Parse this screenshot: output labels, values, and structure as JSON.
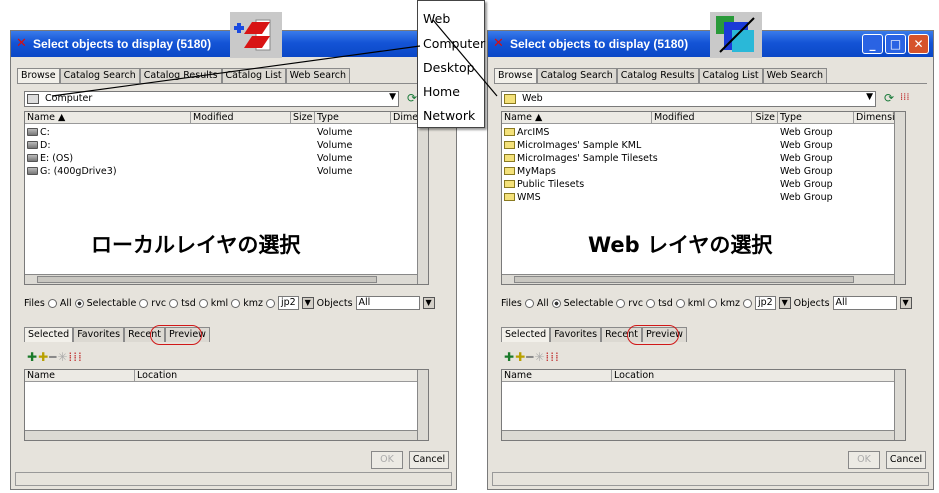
{
  "popup": {
    "items": [
      "Web",
      "Computer",
      "Desktop",
      "Home",
      "Network"
    ]
  },
  "left": {
    "title": "Select objects to display (5180)",
    "tabs": [
      "Browse",
      "Catalog Search",
      "Catalog Results",
      "Catalog List",
      "Web Search"
    ],
    "location": "Computer",
    "columns": [
      "Name ▲",
      "Modified",
      "Size",
      "Type",
      "Dimensions"
    ],
    "rows": [
      {
        "name": "C:",
        "type": "Volume"
      },
      {
        "name": "D:",
        "type": "Volume"
      },
      {
        "name": "E: (OS)",
        "type": "Volume"
      },
      {
        "name": "G: (400gDrive3)",
        "type": "Volume"
      }
    ],
    "overlay": "ローカルレイヤの選択",
    "filters": {
      "files": "Files",
      "all": "All",
      "selectable": "Selectable",
      "rvc": "rvc",
      "tsd": "tsd",
      "kml": "kml",
      "kmz": "kmz",
      "jp2": "jp2",
      "objects": "Objects",
      "objects_value": "All"
    },
    "tabs2": [
      "Selected",
      "Favorites",
      "Recent",
      "Preview"
    ],
    "sel_columns": [
      "Name",
      "Location"
    ],
    "ok": "OK",
    "cancel": "Cancel"
  },
  "right": {
    "title": "Select objects to display (5180)",
    "tabs": [
      "Browse",
      "Catalog Search",
      "Catalog Results",
      "Catalog List",
      "Web Search"
    ],
    "location": "Web",
    "columns": [
      "Name ▲",
      "Modified",
      "Size",
      "Type",
      "Dimensions"
    ],
    "rows": [
      {
        "name": "ArcIMS",
        "type": "Web Group"
      },
      {
        "name": "MicroImages' Sample KML",
        "type": "Web Group"
      },
      {
        "name": "MicroImages' Sample Tilesets",
        "type": "Web Group"
      },
      {
        "name": "MyMaps",
        "type": "Web Group"
      },
      {
        "name": "Public Tilesets",
        "type": "Web Group"
      },
      {
        "name": "WMS",
        "type": "Web Group"
      }
    ],
    "overlay": "Web レイヤの選択",
    "filters": {
      "files": "Files",
      "all": "All",
      "selectable": "Selectable",
      "rvc": "rvc",
      "tsd": "tsd",
      "kml": "kml",
      "kmz": "kmz",
      "jp2": "jp2",
      "objects": "Objects",
      "objects_value": "All"
    },
    "tabs2": [
      "Selected",
      "Favorites",
      "Recent",
      "Preview"
    ],
    "sel_columns": [
      "Name",
      "Location"
    ],
    "ok": "OK",
    "cancel": "Cancel"
  },
  "colors": {
    "titlebar": "#1454d6",
    "highlight_circle": "#d01818",
    "dialog_bg": "#e6e3dc"
  }
}
